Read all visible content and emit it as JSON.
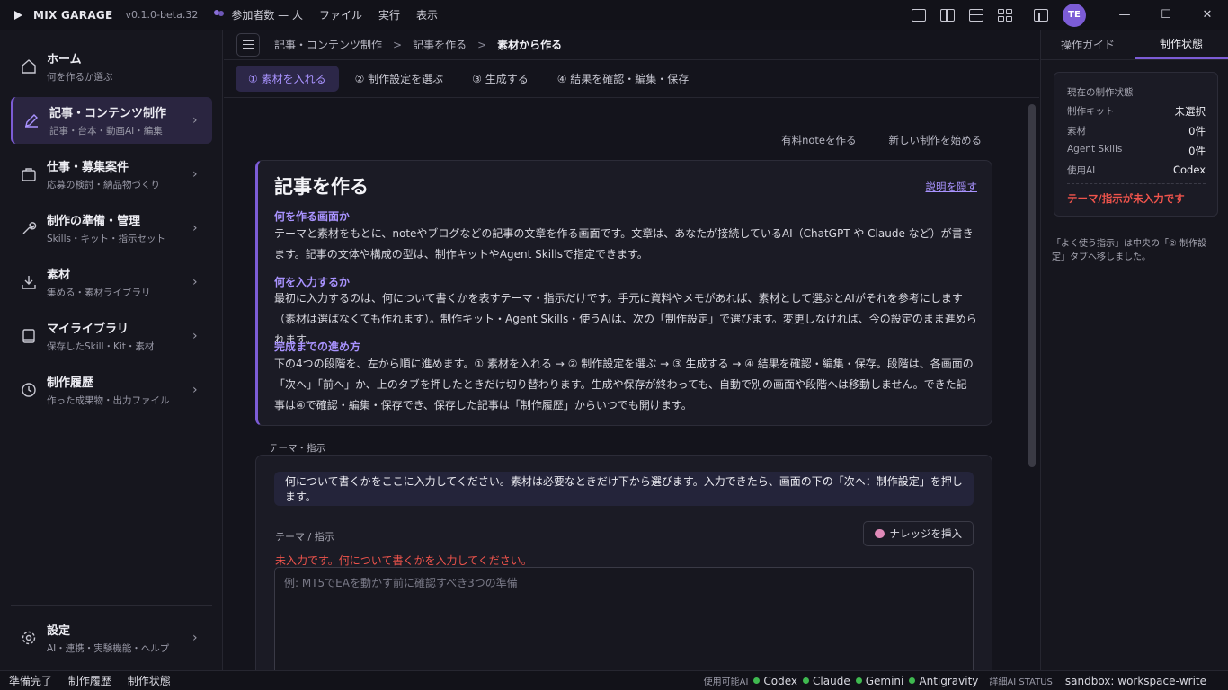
{
  "titlebar": {
    "app_name": "MIX GARAGE",
    "version": "v0.1.0-beta.32",
    "participants": "参加者数 — 人",
    "menus": [
      "ファイル",
      "実行",
      "表示"
    ],
    "avatar": "TE",
    "minimize": "—",
    "maximize": "☐",
    "close": "✕"
  },
  "sidebar": {
    "items": [
      {
        "title": "ホーム",
        "sub": "何を作るか選ぶ",
        "icon": "home-icon"
      },
      {
        "title": "記事・コンテンツ制作",
        "sub": "記事・台本・動画AI・編集",
        "icon": "pen-icon"
      },
      {
        "title": "仕事・募集案件",
        "sub": "応募の検討・納品物づくり",
        "icon": "briefcase-icon"
      },
      {
        "title": "制作の準備・管理",
        "sub": "Skills・キット・指示セット",
        "icon": "wrench-icon"
      },
      {
        "title": "素材",
        "sub": "集める・素材ライブラリ",
        "icon": "download-icon"
      },
      {
        "title": "マイライブラリ",
        "sub": "保存したSkill・Kit・素材",
        "icon": "book-icon"
      },
      {
        "title": "制作履歴",
        "sub": "作った成果物・出力ファイル",
        "icon": "clock-icon"
      }
    ],
    "settings": {
      "title": "設定",
      "sub": "AI・連携・実験機能・ヘルプ",
      "icon": "gear-icon"
    }
  },
  "breadcrumb": [
    "記事・コンテンツ制作",
    "記事を作る",
    "素材から作る"
  ],
  "steps": [
    "① 素材を入れる",
    "② 制作設定を選ぶ",
    "③ 生成する",
    "④ 結果を確認・編集・保存"
  ],
  "top_links": [
    "有料noteを作る",
    "新しい制作を始める"
  ],
  "info": {
    "title": "記事を作る",
    "hide_link": "説明を隠す",
    "sections": [
      {
        "heading": "何を作る画面か",
        "body": "テーマと素材をもとに、noteやブログなどの記事の文章を作る画面です。文章は、あなたが接続しているAI（ChatGPT や Claude など）が書きます。記事の文体や構成の型は、制作キットやAgent Skillsで指定できます。"
      },
      {
        "heading": "何を入力するか",
        "body": "最初に入力するのは、何について書くかを表すテーマ・指示だけです。手元に資料やメモがあれば、素材として選ぶとAIがそれを参考にします（素材は選ばなくても作れます）。制作キット・Agent Skills・使うAIは、次の「制作設定」で選びます。変更しなければ、今の設定のまま進められます。"
      },
      {
        "heading": "完成までの進め方",
        "body": "下の4つの段階を、左から順に進めます。① 素材を入れる → ② 制作設定を選ぶ → ③ 生成する → ④ 結果を確認・編集・保存。段階は、各画面の「次へ」「前へ」か、上のタブを押したときだけ切り替わります。生成や保存が終わっても、自動で別の画面や段階へは移動しません。できた記事は④で確認・編集・保存でき、保存した記事は「制作履歴」からいつでも開けます。"
      }
    ]
  },
  "form": {
    "section_label": "テーマ・指示",
    "hint": "何について書くかをここに入力してください。素材は必要なときだけ下から選びます。入力できたら、画面の下の「次へ：制作設定」を押します。",
    "field_label": "テーマ / 指示",
    "knowledge_button": "ナレッジを挿入",
    "error": "未入力です。何について書くかを入力してください。",
    "placeholder": "例: MT5でEAを動かす前に確認すべき3つの準備",
    "value": ""
  },
  "right_panel": {
    "tabs": [
      "操作ガイド",
      "制作状態"
    ],
    "status_title": "現在の制作状態",
    "rows": [
      {
        "key": "制作キット",
        "value": "未選択"
      },
      {
        "key": "素材",
        "value": "0件"
      },
      {
        "key": "Agent Skills",
        "value": "0件"
      },
      {
        "key": "使用AI",
        "value": "Codex"
      }
    ],
    "warning": "テーマ/指示が未入力です",
    "note": "「よく使う指示」は中央の「② 制作設定」タブへ移しました。"
  },
  "statusbar": {
    "left": [
      "準備完了",
      "制作履歴",
      "制作状態"
    ],
    "ai_label": "使用可能AI",
    "ais": [
      "Codex",
      "Claude",
      "Gemini",
      "Antigravity"
    ],
    "status_label": "詳細AI STATUS",
    "sandbox": "sandbox: workspace-write"
  },
  "colors": {
    "accent": "#7c5cd6",
    "accent_text": "#a993ff",
    "error": "#f0544c",
    "ok": "#3fb950"
  }
}
